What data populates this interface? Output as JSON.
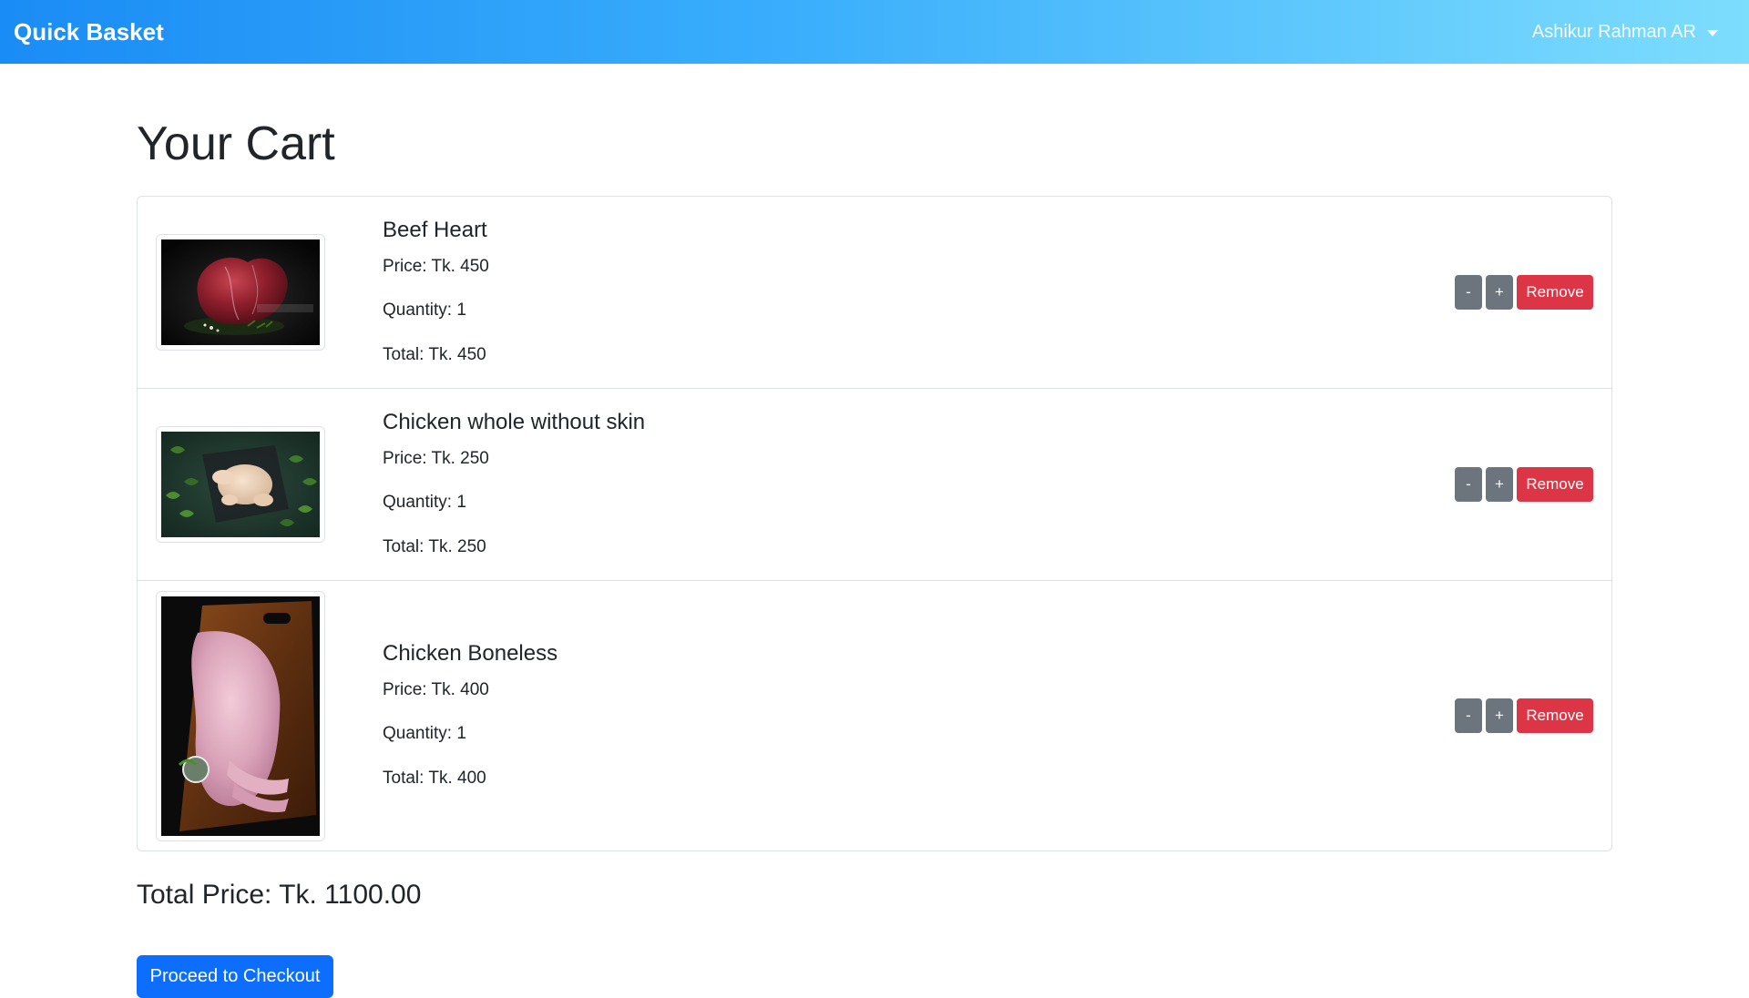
{
  "navbar": {
    "brand": "Quick Basket",
    "user_name": "Ashikur Rahman AR",
    "gradient_colors": [
      "#1a8cf5",
      "#3aaefc",
      "#7dddfd"
    ]
  },
  "page": {
    "title": "Your Cart"
  },
  "cart": {
    "items": [
      {
        "name": "Beef Heart",
        "price": "Price: Tk. 450",
        "quantity": "Quantity: 1",
        "total": "Total: Tk. 450",
        "image": "beef-heart-photo"
      },
      {
        "name": "Chicken whole without skin",
        "price": "Price: Tk. 250",
        "quantity": "Quantity: 1",
        "total": "Total: Tk. 250",
        "image": "whole-chicken-photo"
      },
      {
        "name": "Chicken Boneless",
        "price": "Price: Tk. 400",
        "quantity": "Quantity: 1",
        "total": "Total: Tk. 400",
        "image": "boneless-chicken-photo"
      }
    ],
    "decrease_label": "-",
    "increase_label": "+",
    "remove_label": "Remove"
  },
  "summary": {
    "total_price": "Total Price: Tk. 1100.00",
    "checkout_label": "Proceed to Checkout"
  },
  "colors": {
    "primary": "#0d6efd",
    "danger": "#dc3545",
    "secondary": "#6c757d"
  }
}
